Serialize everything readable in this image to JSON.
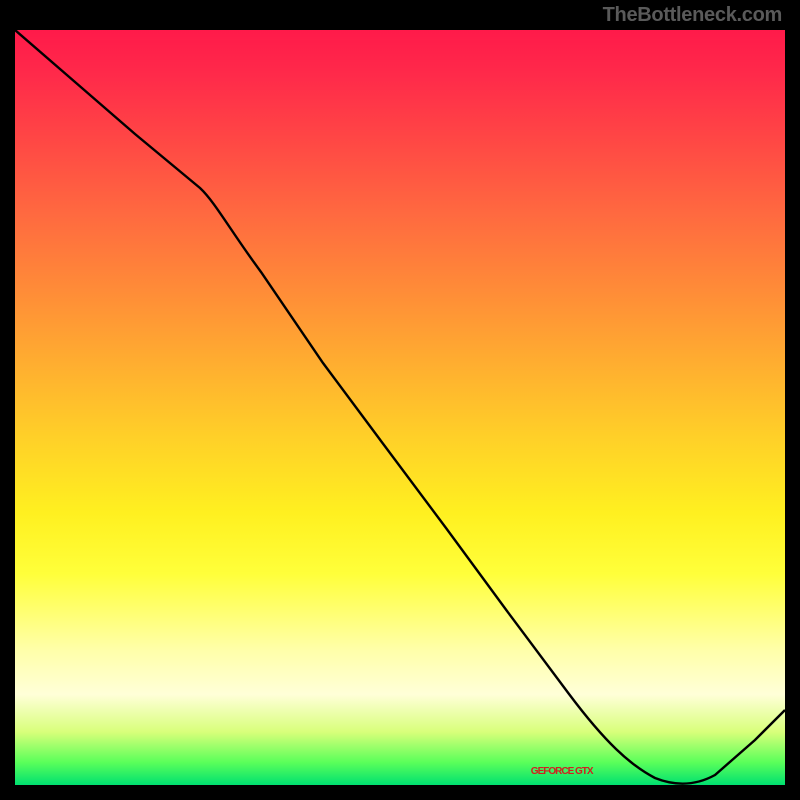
{
  "attribution": "TheBottleneck.com",
  "chart_data": {
    "type": "line",
    "title": "",
    "xlabel": "",
    "ylabel": "",
    "xlim": [
      0,
      100
    ],
    "ylim": [
      0,
      100
    ],
    "series": [
      {
        "name": "curve",
        "x": [
          0,
          8,
          16,
          24,
          32,
          40,
          48,
          56,
          64,
          72,
          80,
          88,
          96,
          100
        ],
        "y": [
          100,
          93,
          86,
          79,
          68,
          56,
          45,
          34,
          23,
          12,
          3,
          0,
          6,
          10
        ]
      }
    ],
    "series_label": "GEFORCE GTX",
    "background": {
      "gradient_top": "#ff1a4a",
      "gradient_mid": "#ffff3a",
      "gradient_bottom": "#00e070"
    }
  }
}
